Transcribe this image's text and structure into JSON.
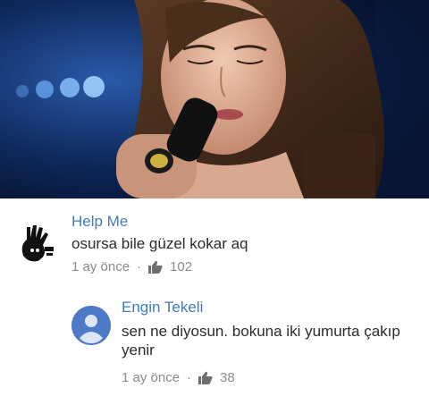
{
  "comments": [
    {
      "author": "Help Me",
      "text": "osursa bile güzel kokar aq",
      "time": "1 ay önce",
      "likes": "102",
      "avatar_icon": "hand-print-avatar"
    },
    {
      "author": "Engin Tekeli",
      "text": "sen ne diyosun. bokuna iki yumurta çakıp yenir",
      "time": "1 ay önce",
      "likes": "38",
      "avatar_icon": "default-user-avatar"
    }
  ],
  "colors": {
    "author": "#3d7cc0",
    "text": "#2b2b2b",
    "meta": "#8a8a8a",
    "default_avatar": "#4d79c7"
  }
}
